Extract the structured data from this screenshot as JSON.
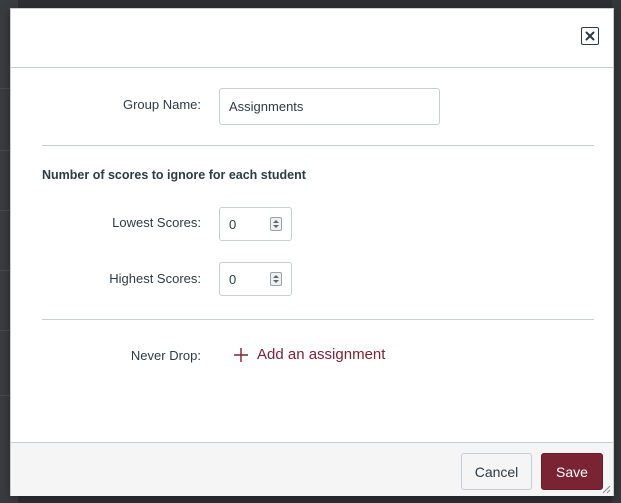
{
  "dialog": {
    "close_icon": "close-icon",
    "group_name": {
      "label": "Group Name:",
      "value": "Assignments"
    },
    "drop_section": {
      "title": "Number of scores to ignore for each student",
      "lowest": {
        "label": "Lowest Scores:",
        "value": "0"
      },
      "highest": {
        "label": "Highest Scores:",
        "value": "0"
      }
    },
    "never_drop": {
      "label": "Never Drop:",
      "add_link": "Add an assignment",
      "add_icon": "plus-icon"
    },
    "footer": {
      "cancel_label": "Cancel",
      "save_label": "Save"
    }
  },
  "colors": {
    "accent": "#7a2332",
    "text": "#2d3b45",
    "border": "#c7cdd1",
    "footer_bg": "#f5f5f5",
    "backdrop": "#2d3033"
  }
}
